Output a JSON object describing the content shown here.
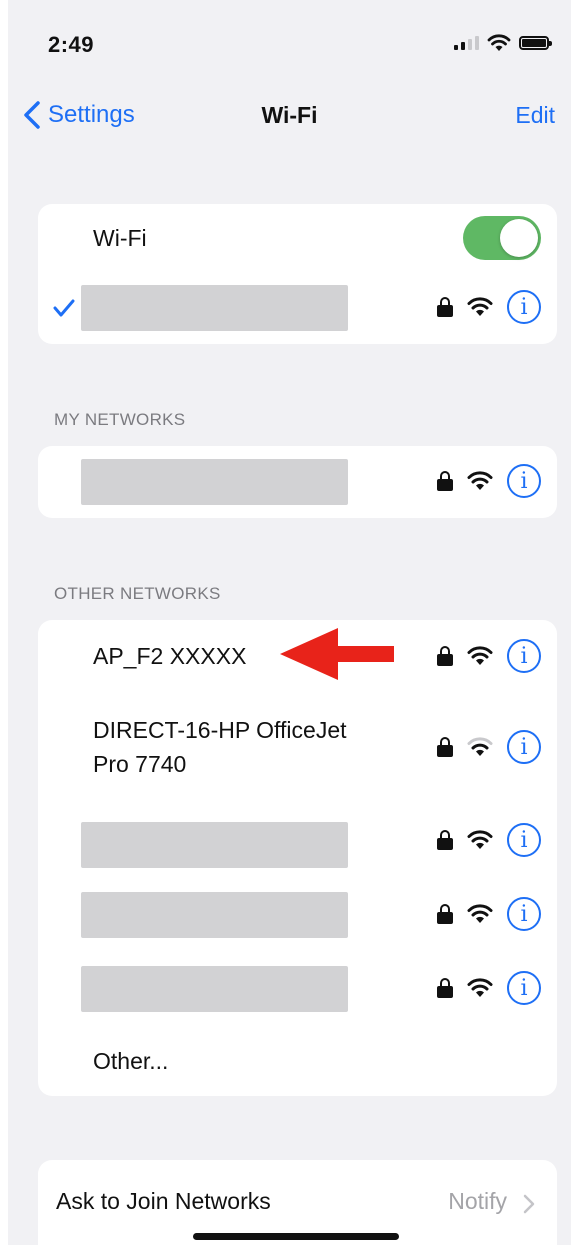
{
  "status_bar": {
    "time": "2:49"
  },
  "nav": {
    "back_label": "Settings",
    "title": "Wi-Fi",
    "edit_label": "Edit"
  },
  "wifi_group": {
    "wifi_label": "Wi-Fi",
    "wifi_on": true,
    "connected_network": ""
  },
  "my_networks": {
    "header": "MY NETWORKS",
    "networks": [
      ""
    ]
  },
  "other_networks": {
    "header": "OTHER NETWORKS",
    "networks": [
      {
        "name": "AP_F2 XXXXX",
        "secured": true
      },
      {
        "name_line1": "DIRECT-16-HP OfficeJet",
        "name_line2": "Pro 7740",
        "secured": true
      },
      {
        "name": "",
        "secured": true
      },
      {
        "name": "",
        "secured": true
      },
      {
        "name": "",
        "secured": true
      }
    ],
    "other_label": "Other..."
  },
  "join": {
    "label": "Ask to Join Networks",
    "value": "Notify"
  },
  "colors": {
    "accent": "#1e6ff5",
    "toggle_on": "#5fb864",
    "annotation_arrow": "#e8231a",
    "redaction": "#d2d2d4"
  }
}
